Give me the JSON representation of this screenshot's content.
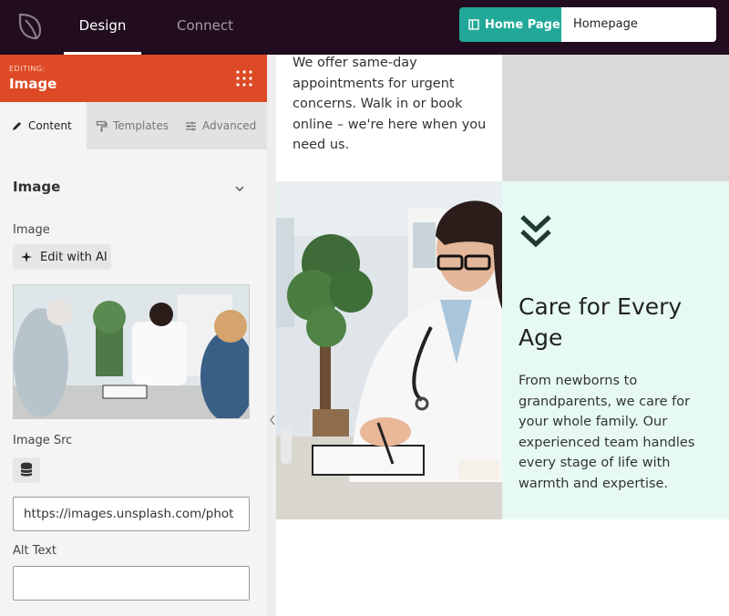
{
  "topbar": {
    "tabs": [
      {
        "label": "Design",
        "active": true
      },
      {
        "label": "Connect",
        "active": false
      }
    ],
    "page_button_label": "Home Page",
    "page_input_value": "Homepage",
    "accent_color": "#21a898",
    "background_color": "#210d1f"
  },
  "sidebar": {
    "editing_label": "EDITING:",
    "editing_title": "Image",
    "header_color": "#dd4a25",
    "tabs": [
      {
        "label": "Content",
        "icon": "pencil-icon",
        "active": true
      },
      {
        "label": "Templates",
        "icon": "paint-roller-icon",
        "active": false
      },
      {
        "label": "Advanced",
        "icon": "sliders-icon",
        "active": false
      }
    ],
    "section_title": "Image",
    "image_label": "Image",
    "ai_button_label": "Edit with AI",
    "image_src_label": "Image Src",
    "image_src_value": "https://images.unsplash.com/phot",
    "alt_text_label": "Alt Text",
    "alt_text_value": ""
  },
  "canvas": {
    "intro_text": "We offer same-day appointments for urgent concerns. Walk in or book online – we're here when you need us.",
    "care_title": "Care for Every Age",
    "care_text": "From newborns to grandparents, we care for your whole family. Our experienced team handles every stage of life with warmth and expertise.",
    "mint_color": "#e6faf3",
    "chevron_color": "#1f3a34"
  }
}
